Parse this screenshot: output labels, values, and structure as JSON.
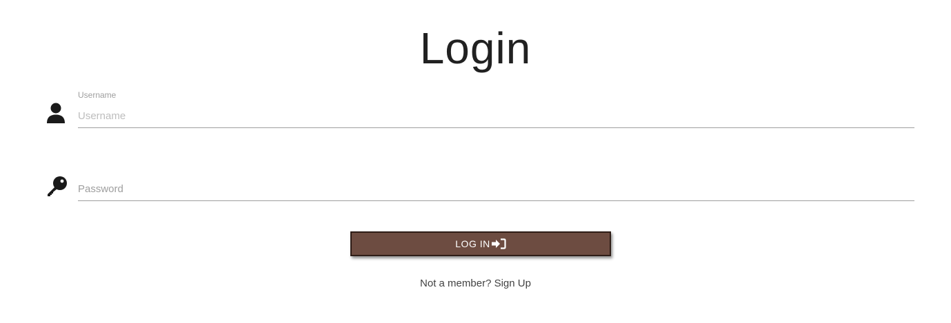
{
  "page": {
    "title": "Login"
  },
  "form": {
    "username": {
      "label": "Username",
      "placeholder": "Username",
      "value": "",
      "icon": "user-icon"
    },
    "password": {
      "placeholder": "Password",
      "value": "",
      "icon": "key-icon"
    },
    "submit": {
      "label": "LOG IN",
      "icon": "sign-in-icon",
      "background": "#6d4c41"
    }
  },
  "footer": {
    "prompt": "Not a member?",
    "link_label": "Sign Up"
  }
}
